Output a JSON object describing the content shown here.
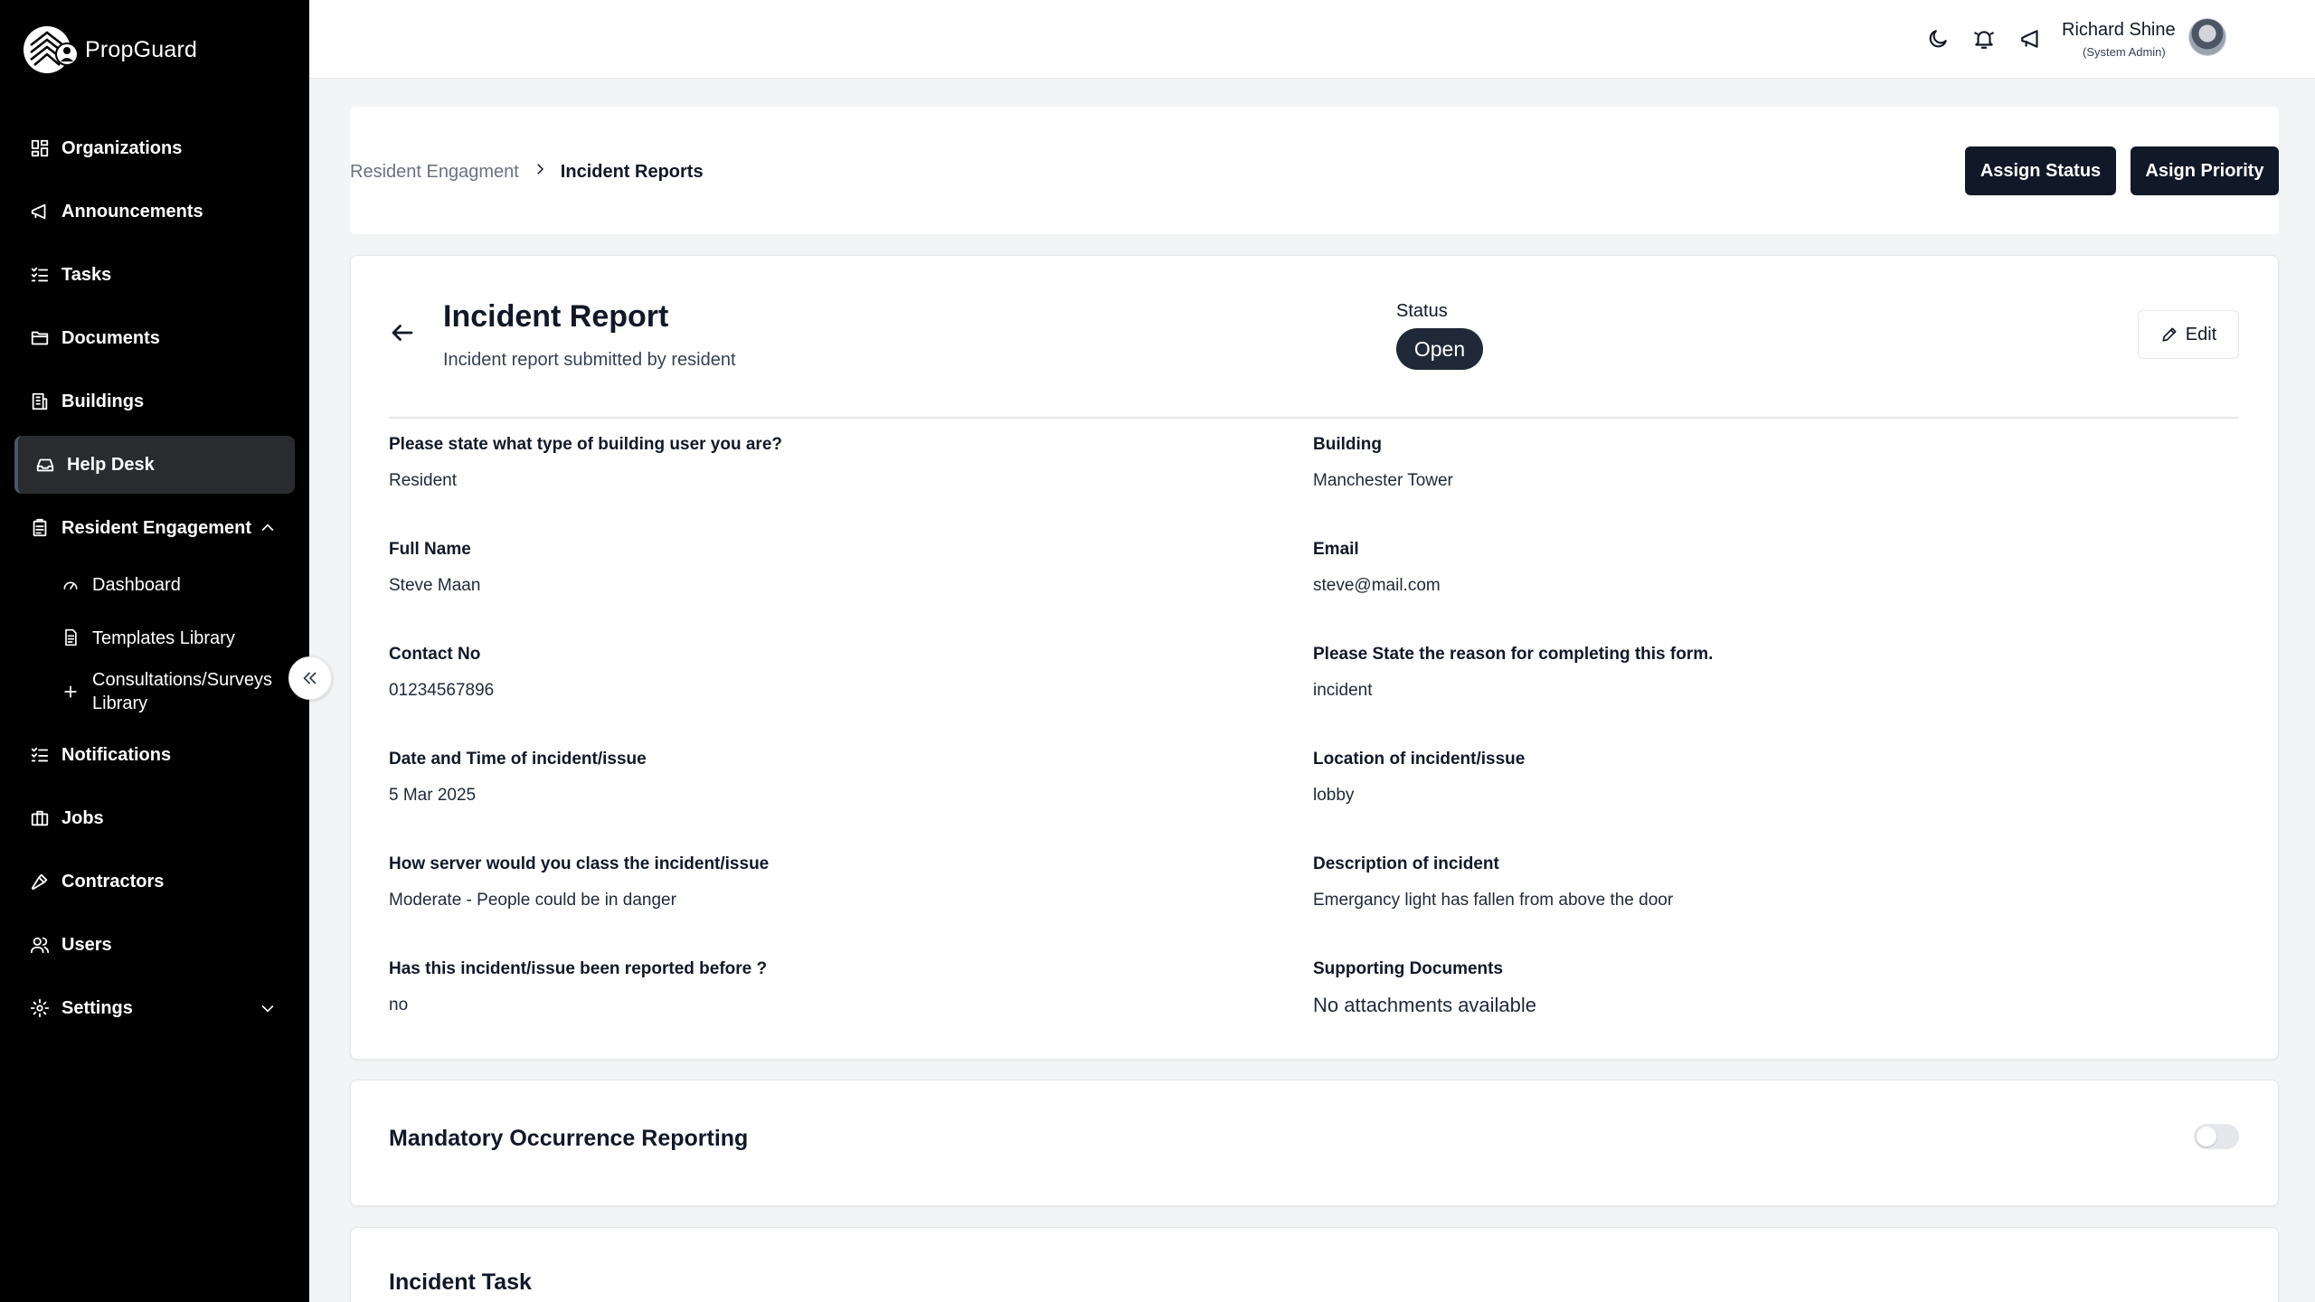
{
  "brand": {
    "name": "PropGuard"
  },
  "sidebar": {
    "items": [
      {
        "label": "Organizations",
        "icon": "grid-icon"
      },
      {
        "label": "Announcements",
        "icon": "megaphone-icon"
      },
      {
        "label": "Tasks",
        "icon": "checklist-icon"
      },
      {
        "label": "Documents",
        "icon": "folder-icon"
      },
      {
        "label": "Buildings",
        "icon": "building-icon"
      },
      {
        "label": "Help Desk",
        "icon": "inbox-icon",
        "active": true
      },
      {
        "label": "Resident Engagement",
        "icon": "clipboard-icon",
        "expanded": true
      },
      {
        "label": "Notifications",
        "icon": "checklist-icon"
      },
      {
        "label": "Jobs",
        "icon": "briefcase-icon"
      },
      {
        "label": "Contractors",
        "icon": "hammer-icon"
      },
      {
        "label": "Users",
        "icon": "users-icon"
      },
      {
        "label": "Settings",
        "icon": "gear-icon"
      }
    ],
    "sub_items": [
      {
        "label": "Dashboard",
        "icon": "gauge-icon"
      },
      {
        "label": "Templates Library",
        "icon": "file-icon"
      },
      {
        "label_line1": "Consultations/Surveys",
        "label_line2": "Library",
        "icon": "plus-icon"
      }
    ]
  },
  "header": {
    "user_name": "Richard Shine",
    "user_role": "(System Admin)"
  },
  "breadcrumb": {
    "parent": "Resident Engagment",
    "current": "Incident Reports"
  },
  "actions": {
    "assign_status": "Assign Status",
    "assign_priority": "Asign Priority"
  },
  "report": {
    "title": "Incident Report",
    "subtitle": "Incident report submitted by resident",
    "status_label": "Status",
    "status_value": "Open",
    "edit_label": "Edit",
    "fields": [
      {
        "q": "Please state what type of building user you are?",
        "a": "Resident"
      },
      {
        "q": "Building",
        "a": "Manchester Tower"
      },
      {
        "q": "Full Name",
        "a": "Steve Maan"
      },
      {
        "q": "Email",
        "a": "steve@mail.com"
      },
      {
        "q": "Contact No",
        "a": "01234567896"
      },
      {
        "q": "Please State the reason for completing this form.",
        "a": "incident"
      },
      {
        "q": "Date and Time of incident/issue",
        "a": "5 Mar 2025"
      },
      {
        "q": "Location of incident/issue",
        "a": "lobby"
      },
      {
        "q": "How server would you class the incident/issue",
        "a": "Moderate - People could be in danger"
      },
      {
        "q": "Description of incident",
        "a": "Emergancy light has fallen from above the door"
      },
      {
        "q": "Has this incident/issue been reported before ?",
        "a": "no"
      },
      {
        "q": "Supporting Documents",
        "a": "No attachments available"
      }
    ]
  },
  "mor": {
    "title": "Mandatory Occurrence Reporting",
    "enabled": false
  },
  "task": {
    "title": "Incident Task"
  },
  "colors": {
    "sidebar_bg": "#000000",
    "primary": "#111827",
    "page_bg": "#f3f4f6"
  }
}
